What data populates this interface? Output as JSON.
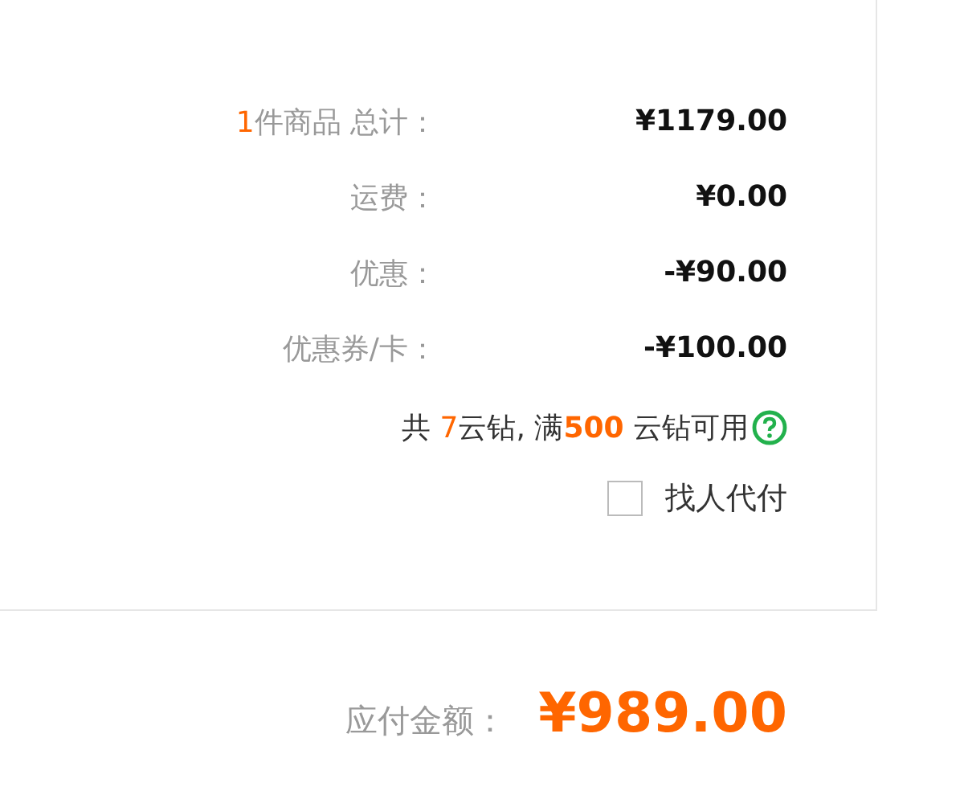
{
  "summary": {
    "rows": [
      {
        "count": "1",
        "label": "件商品 总计：",
        "value": "¥1179.00"
      },
      {
        "label": "运费：",
        "value": "¥0.00"
      },
      {
        "label": "优惠：",
        "value": "-¥90.00"
      },
      {
        "label": "优惠券/卡：",
        "value": "-¥100.00"
      }
    ],
    "coins": [
      {
        "text": "共 ",
        "kind": "plain"
      },
      {
        "text": "7",
        "kind": "count"
      },
      {
        "text": "云钻, 满",
        "kind": "plain"
      },
      {
        "text": "500",
        "kind": "threshold"
      },
      {
        "text": " 云钻可用",
        "kind": "plain"
      }
    ],
    "proxy_pay": {
      "label": "找人代付",
      "checked": false
    }
  },
  "total": {
    "label": "应付金额：",
    "value": "¥989.00"
  }
}
